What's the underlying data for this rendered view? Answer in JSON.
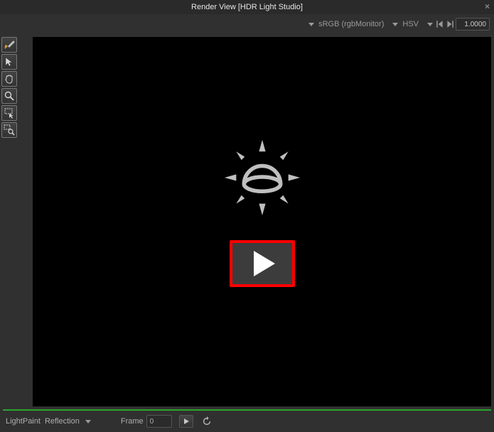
{
  "window": {
    "title": "Render View [HDR Light Studio]"
  },
  "topbar": {
    "colorspace": "sRGB (rgbMonitor)",
    "display": "HSV",
    "value_field": "1.0000"
  },
  "tools": {
    "items": [
      {
        "name": "paint-brush-icon"
      },
      {
        "name": "pointer-icon"
      },
      {
        "name": "hand-pan-icon"
      },
      {
        "name": "magnify-icon"
      },
      {
        "name": "region-select-icon"
      },
      {
        "name": "region-zoom-icon"
      }
    ]
  },
  "viewport": {
    "logo": "sun-dome-icon",
    "play_button": "play-video-button"
  },
  "status": {
    "lightpaint_label": "LightPaint",
    "mode_label": "Reflection",
    "frame_label": "Frame",
    "frame_value": "0"
  }
}
